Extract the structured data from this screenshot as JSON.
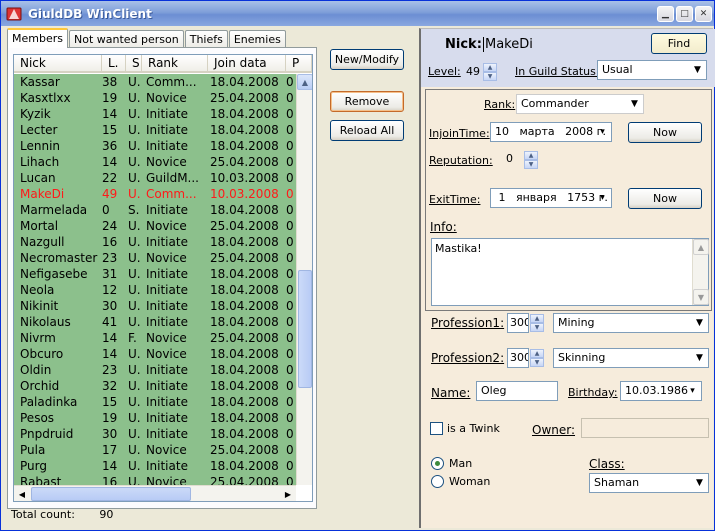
{
  "window": {
    "title": "GiuldDB WinClient"
  },
  "tabs": [
    "Members",
    "Not wanted person",
    "Thiefs",
    "Enemies"
  ],
  "grid": {
    "columns": [
      "Nick",
      "L.",
      "S",
      "Rank",
      "Join data",
      "P"
    ],
    "rows": [
      [
        "Kassar",
        "38",
        "U.",
        "Comm...",
        "18.04.2008",
        "0"
      ],
      [
        "Kasxtlxx",
        "19",
        "U.",
        "Novice",
        "25.04.2008",
        "0"
      ],
      [
        "Kyzik",
        "14",
        "U.",
        "Initiate",
        "18.04.2008",
        "0"
      ],
      [
        "Lecter",
        "15",
        "U.",
        "Initiate",
        "18.04.2008",
        "0"
      ],
      [
        "Lennin",
        "36",
        "U.",
        "Initiate",
        "18.04.2008",
        "0"
      ],
      [
        "Lihach",
        "14",
        "U.",
        "Novice",
        "25.04.2008",
        "0"
      ],
      [
        "Lucan",
        "22",
        "U.",
        "GuildM...",
        "10.03.2008",
        "0"
      ],
      [
        "MakeDi",
        "49",
        "U.",
        "Comm...",
        "10.03.2008",
        "0"
      ],
      [
        "Marmelada",
        "0",
        "S.",
        "Initiate",
        "18.04.2008",
        "0"
      ],
      [
        "Mortal",
        "24",
        "U.",
        "Novice",
        "25.04.2008",
        "0"
      ],
      [
        "Nazgull",
        "16",
        "U.",
        "Initiate",
        "18.04.2008",
        "0"
      ],
      [
        "Necromaster",
        "23",
        "U.",
        "Novice",
        "25.04.2008",
        "0"
      ],
      [
        "Nefigasebe",
        "31",
        "U.",
        "Initiate",
        "18.04.2008",
        "0"
      ],
      [
        "Neola",
        "12",
        "U.",
        "Initiate",
        "18.04.2008",
        "0"
      ],
      [
        "Nikinit",
        "30",
        "U.",
        "Initiate",
        "18.04.2008",
        "0"
      ],
      [
        "Nikolaus",
        "41",
        "U.",
        "Initiate",
        "18.04.2008",
        "0"
      ],
      [
        "Nivrm",
        "14",
        "F.",
        "Novice",
        "25.04.2008",
        "0"
      ],
      [
        "Obcuro",
        "14",
        "U.",
        "Novice",
        "18.04.2008",
        "0"
      ],
      [
        "Oldin",
        "23",
        "U.",
        "Initiate",
        "18.04.2008",
        "0"
      ],
      [
        "Orchid",
        "32",
        "U.",
        "Initiate",
        "18.04.2008",
        "0"
      ],
      [
        "Paladinka",
        "15",
        "U.",
        "Initiate",
        "18.04.2008",
        "0"
      ],
      [
        "Pesos",
        "19",
        "U.",
        "Initiate",
        "18.04.2008",
        "0"
      ],
      [
        "Pnpdruid",
        "30",
        "U.",
        "Initiate",
        "18.04.2008",
        "0"
      ],
      [
        "Pula",
        "17",
        "U.",
        "Novice",
        "25.04.2008",
        "0"
      ],
      [
        "Purg",
        "14",
        "U.",
        "Initiate",
        "18.04.2008",
        "0"
      ],
      [
        "Rabast",
        "16",
        "U.",
        "Novice",
        "25.04.2008",
        "0"
      ]
    ],
    "selected_index": 7
  },
  "footer": {
    "total_label": "Total count:",
    "total_value": "90"
  },
  "actions": {
    "new_modify": "New/Modify",
    "remove": "Remove",
    "reload_all": "Reload All"
  },
  "detail": {
    "nick_label": "Nick:",
    "nick_value": "MakeDi",
    "find": "Find",
    "level_label": "Level:",
    "level_value": "49",
    "status_label": "In Guild Status:",
    "status_value": "Usual",
    "rank_label": "Rank:",
    "rank_value": "Commander",
    "join_label": "InjoinTime:",
    "join_day": "10",
    "join_month": "марта",
    "join_year": "2008 г.",
    "now": "Now",
    "reputation_label": "Reputation:",
    "reputation_value": "0",
    "exit_label": "ExitTime:",
    "exit_day": "1",
    "exit_month": "января",
    "exit_year": "1753 г.",
    "info_label": "Info:",
    "info_value": "Mastika!",
    "prof1_label": "Profession1:",
    "prof1_skill": "300",
    "prof1_value": "Mining",
    "prof2_label": "Profession2:",
    "prof2_skill": "300",
    "prof2_value": "Skinning",
    "name_label": "Name:",
    "name_value": "Oleg",
    "birthday_label": "Birthday:",
    "birthday_value": "10.03.1986",
    "twink_label": "is a Twink",
    "owner_label": "Owner:",
    "owner_value": "",
    "man_label": "Man",
    "woman_label": "Woman",
    "class_label": "Class:",
    "class_value": "Shaman"
  },
  "colors": {
    "row_bg": "#8cc08c",
    "selected_text": "#ff1a1a",
    "panel_bg": "#f6ecdc",
    "header_bg": "#d7dced"
  }
}
